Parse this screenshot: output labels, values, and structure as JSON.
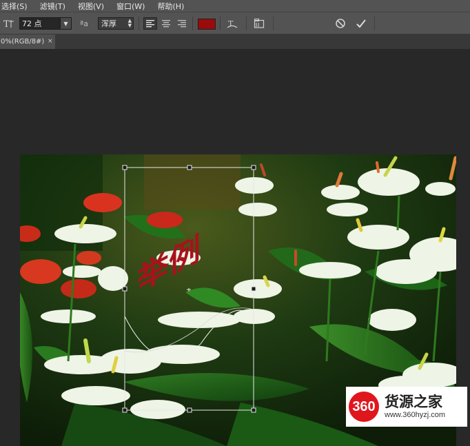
{
  "menu": {
    "items": [
      "选择(S)",
      "滤镜(T)",
      "视图(V)",
      "窗口(W)",
      "帮助(H)"
    ]
  },
  "options": {
    "font_size": "72 点",
    "aa_icon_text": "ªa",
    "antialias": "浑厚",
    "text_color": "#9a0b0b"
  },
  "document": {
    "tab_label": "0%(RGB/8#)",
    "close_glyph": "×"
  },
  "canvas": {
    "text_content": "举例",
    "text_color": "#a8121a"
  },
  "watermark": {
    "badge": "360",
    "name": "货源之家",
    "url": "www.360hyzj.com"
  },
  "icons": {
    "text_tool": "text-orientation-icon",
    "antialias": "antialias-icon",
    "align_left": "align-left-icon",
    "align_center": "align-center-icon",
    "align_right": "align-right-icon",
    "warp": "warp-text-icon",
    "panels": "character-panel-icon",
    "cancel": "cancel-icon",
    "commit": "commit-icon"
  }
}
